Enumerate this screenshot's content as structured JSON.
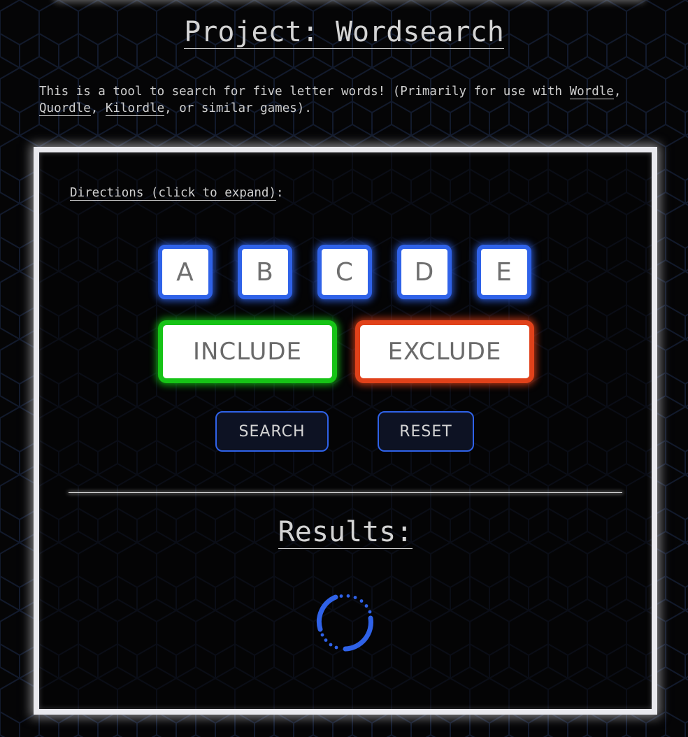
{
  "page": {
    "title": "Project: Wordsearch"
  },
  "intro": {
    "text_before": "This is a tool to search for five letter words! (Primarily for use with ",
    "links": [
      "Wordle",
      "Quordle",
      "Kilordle"
    ],
    "sep1": ", ",
    "sep2": ", ",
    "text_after": ", or similar games)."
  },
  "panel": {
    "directions_link": "Directions (click to expand)",
    "directions_colon": ":",
    "letters": [
      "A",
      "B",
      "C",
      "D",
      "E"
    ],
    "include_label": "INCLUDE",
    "exclude_label": "EXCLUDE",
    "search_label": "SEARCH",
    "reset_label": "RESET",
    "results_title": "Results:"
  },
  "colors": {
    "background": "#050506",
    "letter_border": "#2f62e8",
    "include_border": "#16c316",
    "exclude_border": "#e0411a",
    "action_border": "#2f62e8",
    "spinner": "#2f62e8"
  },
  "status": {
    "loading_icon": "spinner-icon"
  }
}
